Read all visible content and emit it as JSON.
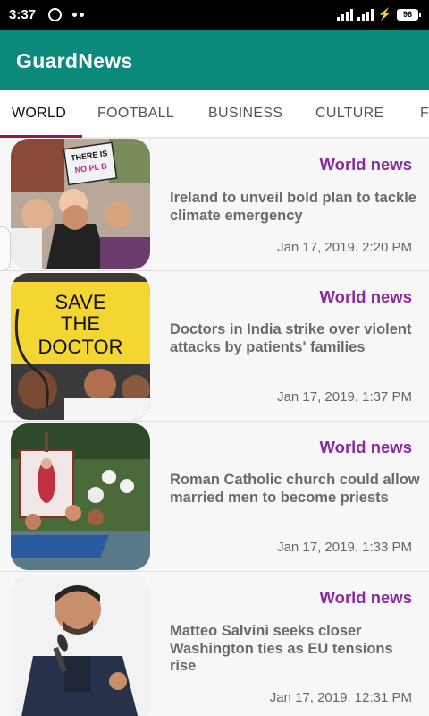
{
  "status_bar": {
    "time": "3:37",
    "battery": "96"
  },
  "app_bar": {
    "title": "GuardNews"
  },
  "tabs": [
    {
      "label": "WORLD",
      "active": true
    },
    {
      "label": "FOOTBALL",
      "active": false
    },
    {
      "label": "BUSINESS",
      "active": false
    },
    {
      "label": "CULTURE",
      "active": false
    },
    {
      "label": "F",
      "active": false
    }
  ],
  "articles": [
    {
      "section": "World news",
      "headline": "Ireland to unveil bold plan to tackle climate emergency",
      "date": "Jan 17, 2019. 2:20 PM",
      "image_sign_text": "THERE IS NO PLANET B"
    },
    {
      "section": "World news",
      "headline": "Doctors in India strike over violent attacks by patients' families",
      "date": "Jan 17, 2019. 1:37 PM",
      "image_sign_text": "SAVE THE DOCTOR"
    },
    {
      "section": "World news",
      "headline": "Roman Catholic church could allow married men to become priests",
      "date": "Jan 17, 2019. 1:33 PM"
    },
    {
      "section": "World news",
      "headline": "Matteo Salvini seeks closer Washington ties as EU tensions rise",
      "date": "Jan 17, 2019. 12:31 PM"
    }
  ],
  "colors": {
    "app_bar": "#0b8a7c",
    "section_label": "#8a2aa0",
    "tab_indicator": "#8e1b4f"
  }
}
